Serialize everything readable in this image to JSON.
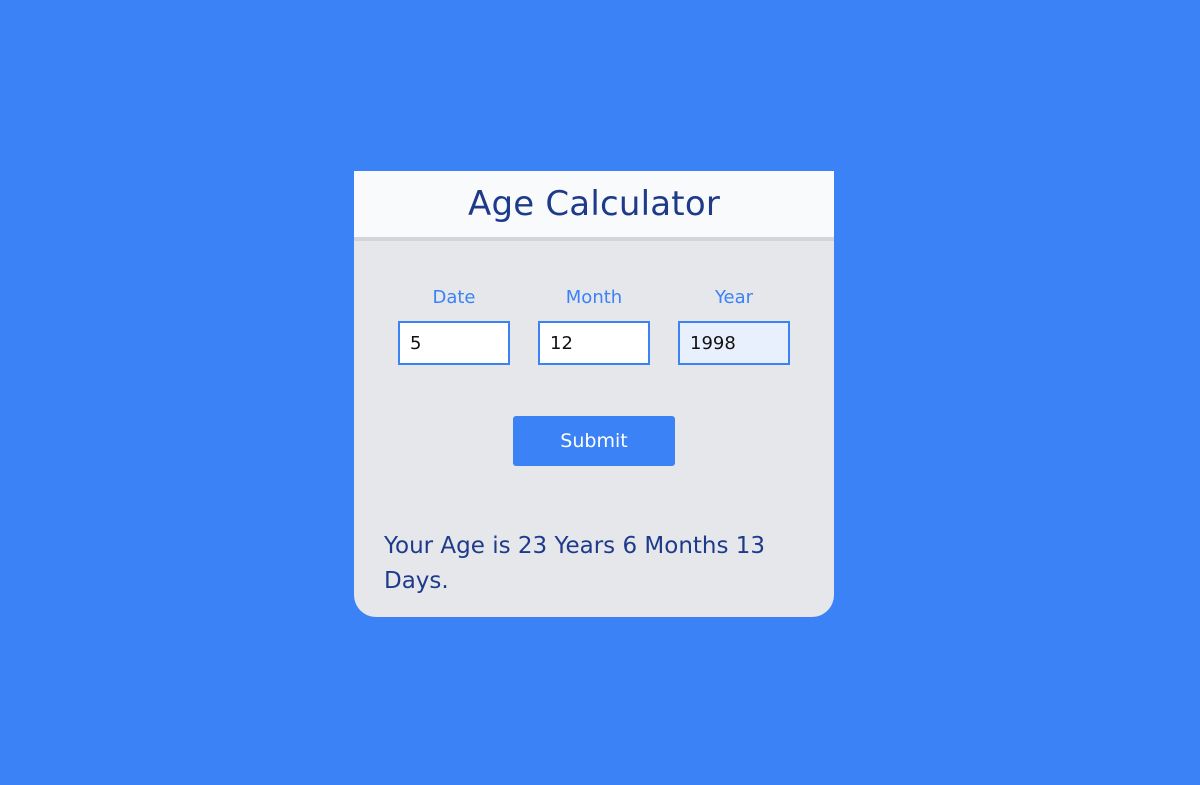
{
  "colors": {
    "background": "#3b82f6",
    "accent": "#3b82f6",
    "title": "#1e3a8a",
    "card": "#e5e7eb",
    "header": "#f8fafc"
  },
  "app": {
    "title": "Age Calculator"
  },
  "form": {
    "date": {
      "label": "Date",
      "value": "5"
    },
    "month": {
      "label": "Month",
      "value": "12"
    },
    "year": {
      "label": "Year",
      "value": "1998"
    },
    "submit_label": "Submit"
  },
  "result": {
    "text": "Your Age is 23 Years 6 Months 13 Days."
  }
}
